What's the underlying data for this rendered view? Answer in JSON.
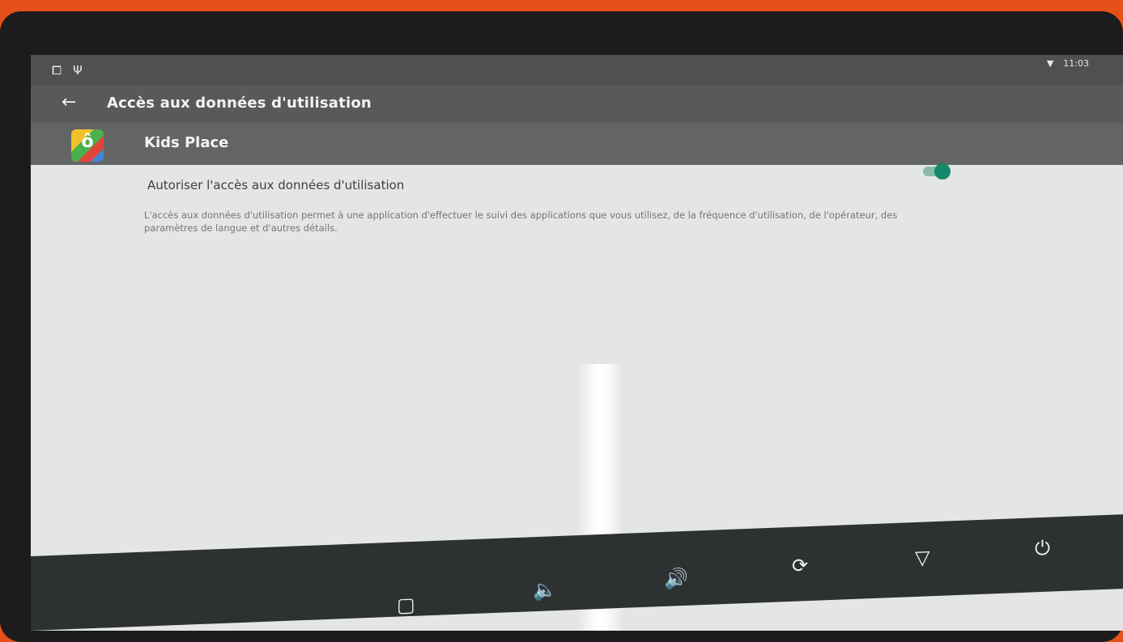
{
  "status_bar": {
    "left_icons": [
      "screenshot-icon",
      "usb-icon"
    ],
    "wifi_icon": "wifi-icon",
    "time": "11:03"
  },
  "toolbar": {
    "back_glyph": "←",
    "title": "Accès aux données d'utilisation"
  },
  "app": {
    "name": "Kids Place"
  },
  "setting": {
    "label": "Autoriser l'accès aux données d'utilisation",
    "enabled": true,
    "description": "L'accès aux données d'utilisation permet à une application d'effectuer le suivi des applications que vous utilisez, de la fréquence d'utilisation, de l'opérateur, des paramètres de langue et d'autres détails."
  },
  "colors": {
    "toggle_on": "#15896a",
    "toolbar": "#585959",
    "background": "#e4e6e6"
  },
  "nav_bar": {
    "buttons": [
      {
        "name": "recents-icon",
        "glyph": "▢"
      },
      {
        "name": "volume-down-icon",
        "glyph": "🔈"
      },
      {
        "name": "volume-up-icon",
        "glyph": "🔊"
      },
      {
        "name": "rotate-icon",
        "glyph": "⟳"
      },
      {
        "name": "back-icon",
        "glyph": "▽"
      },
      {
        "name": "power-icon",
        "glyph": "⏻"
      }
    ]
  }
}
